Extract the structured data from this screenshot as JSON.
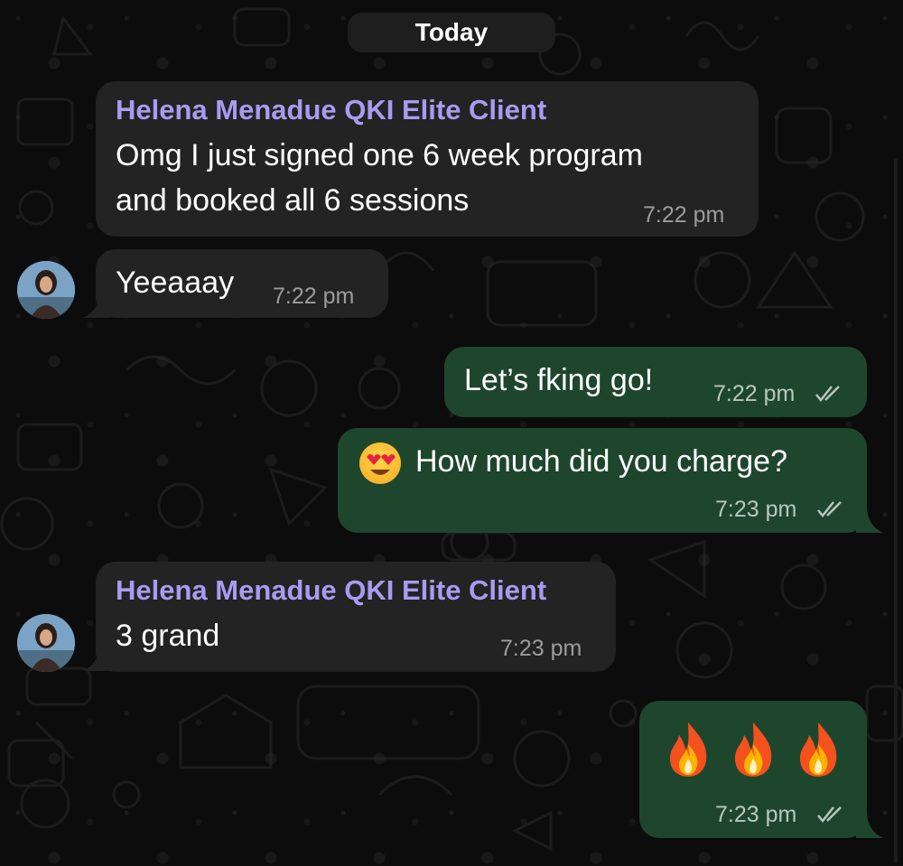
{
  "date_separator": "Today",
  "colors": {
    "incoming_bubble": "#232323",
    "outgoing_bubble": "#1e462d",
    "sender_name": "#a89bf0",
    "timestamp": "#9c9c9c"
  },
  "messages": [
    {
      "direction": "incoming",
      "sender": "Helena Menadue QKI Elite Client",
      "lines": [
        "Omg I just signed one 6 week program",
        "and booked all 6 sessions"
      ],
      "time": "7:22 pm"
    },
    {
      "direction": "incoming",
      "text": "Yeeaaay",
      "time": "7:22 pm",
      "avatar": "helena-avatar"
    },
    {
      "direction": "outgoing",
      "text": "Let’s fking go!",
      "time": "7:22 pm",
      "status": "read-double-check-icon"
    },
    {
      "direction": "outgoing",
      "emoji": "heart-eyes-emoji-icon",
      "text": "How much did you charge?",
      "time": "7:23 pm",
      "status": "read-double-check-icon"
    },
    {
      "direction": "incoming",
      "sender": "Helena Menadue QKI Elite Client",
      "text": "3 grand",
      "time": "7:23 pm",
      "avatar": "helena-avatar"
    },
    {
      "direction": "outgoing",
      "emojis": [
        "fire-emoji-icon",
        "fire-emoji-icon",
        "fire-emoji-icon"
      ],
      "time": "7:23 pm",
      "status": "read-double-check-icon"
    }
  ]
}
